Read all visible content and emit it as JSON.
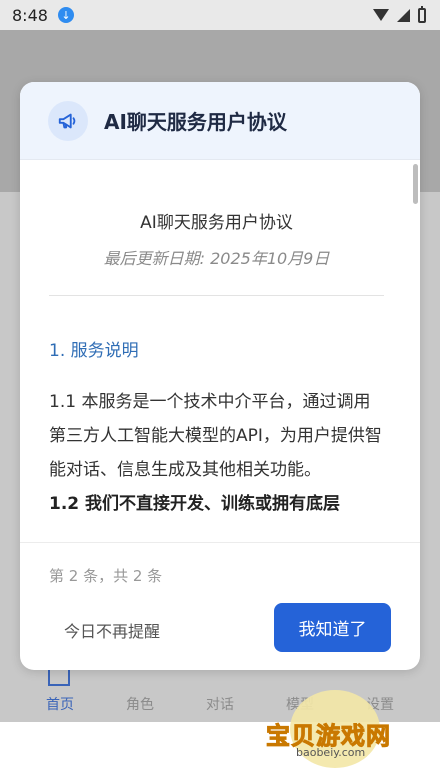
{
  "status_bar": {
    "time": "8:48"
  },
  "background_nav": {
    "items": [
      {
        "label": "首页"
      },
      {
        "label": "角色"
      },
      {
        "label": "对话"
      },
      {
        "label": "模型"
      },
      {
        "label": "设置"
      }
    ],
    "active_color": "#3a64b8"
  },
  "modal": {
    "header_title": "AI聊天服务用户协议",
    "header_icon": "megaphone-icon",
    "doc_title": "AI聊天服务用户协议",
    "last_updated": "最后更新日期: 2025年10月9日",
    "section_1_heading": "1. 服务说明",
    "section_1_1": "1.1 本服务是一个技术中介平台，通过调用第三方人工智能大模型的API，为用户提供智能对话、信息生成及其他相关功能。",
    "section_1_2": "1.2 我们不直接开发、训练或拥有底层",
    "counter": "第 2 条，共 2 条",
    "dismiss_label": "今日不再提醒",
    "ok_label": "我知道了",
    "accent_color": "#2563d8"
  },
  "watermark": {
    "text": "宝贝游戏网",
    "url": "baobeiy.com"
  }
}
